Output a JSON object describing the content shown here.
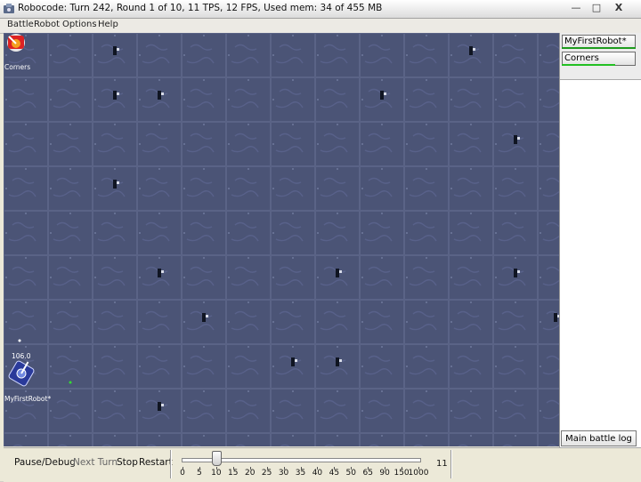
{
  "window": {
    "title": "Robocode: Turn 242, Round 1 of 10, 11 TPS, 12 FPS, Used mem: 34 of 455 MB",
    "controls": {
      "minimize": "—",
      "maximize": "□",
      "close": "X"
    }
  },
  "menu": [
    "Battle",
    "Robot",
    "Options",
    "Help"
  ],
  "arena": {
    "robots": [
      {
        "name": "Corners"
      },
      {
        "name": "MyFirstRobot*",
        "energy": "106.0"
      }
    ]
  },
  "sidebar": {
    "robots": [
      {
        "name": "MyFirstRobot*",
        "energy_fraction": 1.0,
        "energy_color": "#1e9c1e"
      },
      {
        "name": "Corners",
        "energy_fraction": 0.72,
        "energy_color": "#22c022"
      }
    ],
    "log_button": "Main battle log"
  },
  "controls": {
    "pause": "Pause/Debug",
    "next_turn": "Next Turn",
    "stop": "Stop",
    "restart": "Restart",
    "tps_ticks": [
      "0",
      "5",
      "10",
      "15",
      "20",
      "25",
      "30",
      "35",
      "40",
      "45",
      "50",
      "65",
      "90",
      "150",
      "1000"
    ],
    "tps_slider_index": 2,
    "tps_value": "11"
  }
}
